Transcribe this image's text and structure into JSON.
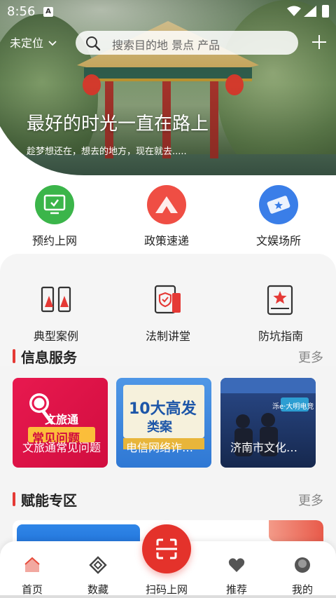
{
  "status_bar": {
    "time": "8:56"
  },
  "header": {
    "location": "未定位",
    "search_placeholder": "搜索目的地 景点 产品"
  },
  "hero": {
    "title": "最好的时光一直在路上",
    "subtitle": "趁梦想还在，想去的地方，现在就去....."
  },
  "quick_actions": [
    {
      "label": "预约上网",
      "color": "#3bb54a"
    },
    {
      "label": "政策速递",
      "color": "#ef4e44"
    },
    {
      "label": "文娱场所",
      "color": "#3a7ee8"
    }
  ],
  "tools": [
    {
      "label": "典型案例"
    },
    {
      "label": "法制讲堂"
    },
    {
      "label": "防坑指南"
    }
  ],
  "info_section": {
    "title": "信息服务",
    "more": "更多",
    "cards": [
      {
        "caption": "文旅通常见问题",
        "art_text": "文旅通",
        "art_text2": "常见问题"
      },
      {
        "caption": "电信网络诈骗十大高发类案",
        "art_text": "10大高发",
        "art_text2": "类案"
      },
      {
        "caption": "济南市文化和旅游",
        "art_text": "泺e·大明电竞"
      }
    ]
  },
  "empower_section": {
    "title": "赋能专区",
    "more": "更多"
  },
  "tabbar": {
    "items": [
      {
        "label": "首页"
      },
      {
        "label": "数藏"
      },
      {
        "label": "扫码上网"
      },
      {
        "label": "推荐"
      },
      {
        "label": "我的"
      }
    ]
  }
}
